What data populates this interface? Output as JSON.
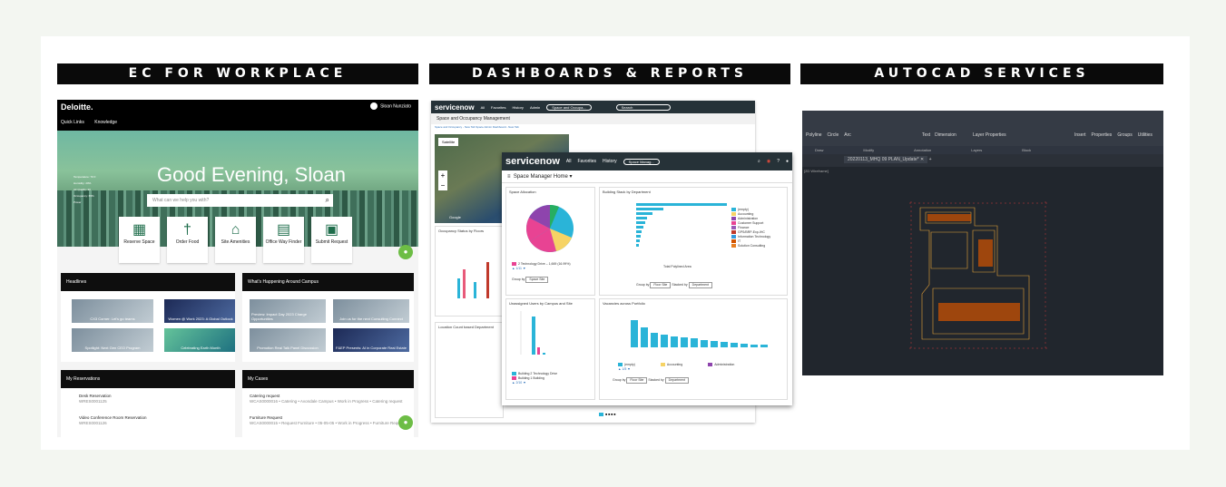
{
  "sections": [
    {
      "title": "EC FOR WORKPLACE"
    },
    {
      "title": "DASHBOARDS & REPORTS"
    },
    {
      "title": "AUTOCAD SERVICES"
    }
  ],
  "workplace": {
    "logo": "Deloitte.",
    "user": "Sloan Nunziato",
    "nav": [
      "Quick Links",
      "Knowledge"
    ],
    "greeting": "Good Evening, Sloan",
    "search_placeholder": "What can we help you with?",
    "weather": [
      "Temperature: 70 F",
      "Humidity: 20%",
      "Air Quality: 30",
      "Occupancy: 65%",
      "Power"
    ],
    "tiles": [
      {
        "icon": "calendar-icon",
        "label": "Reserve Space"
      },
      {
        "icon": "fork-knife-icon",
        "label": "Order Food"
      },
      {
        "icon": "building-icon",
        "label": "Site Amenities"
      },
      {
        "icon": "map-icon",
        "label": "Office Way Finder"
      },
      {
        "icon": "briefcase-icon",
        "label": "Submit Request"
      }
    ],
    "headlines": {
      "title": "Headlines",
      "items": [
        "CX3 Corner: Let's go teams",
        "Women @ Work 2023: A Global Outlook",
        "Spotlight: Next Gen CEO Program",
        "Celebrating Earth Month"
      ]
    },
    "campus": {
      "title": "What's Happening Around Campus",
      "items": [
        "Preview: Impact Day 2023 Charge Opportunities",
        "Join us for the next Consulting Connect",
        "Promotion Real Talk Panel Discussion",
        "F&EP Presents: AI in Corporate Real Estate"
      ]
    },
    "reservations": {
      "title": "My Reservations",
      "items": [
        {
          "name": "Desk Reservation",
          "id": "WRES0001125"
        },
        {
          "name": "Video Conference Room Reservation",
          "id": "WRES0001126"
        }
      ]
    },
    "cases": {
      "title": "My Cases",
      "items": [
        {
          "name": "Catering request",
          "detail": "WCAS0000016 • Catering • Avondale Campus • Work in Progress • Catering request"
        },
        {
          "name": "Furniture Request",
          "detail": "WCAS0000015 • Request Furniture • 05-05-05 • Work in Progress • Furniture Request"
        }
      ]
    }
  },
  "dashboard_back": {
    "logo": "servicenow",
    "menu": [
      "All",
      "Favorites",
      "History",
      "Admin"
    ],
    "pill": "Space and Occupa...",
    "search": "Search",
    "subtitle": "Space and Occupancy Management",
    "tabs": "Space and Occupancy - New Tab  Space Admin Dashboard - New Tab",
    "map_mode": "Satellite",
    "map_credit": "Google",
    "occ_title": "Occupancy Status by Floors",
    "loc_title": "Location Count based Department"
  },
  "dashboard_front": {
    "logo": "servicenow",
    "menu": [
      "All",
      "Favorites",
      "History"
    ],
    "pill": "Space Manag...",
    "title": "Space Manager Home",
    "space_alloc": {
      "title": "Space Allocation",
      "legend": "2 Technology Drive – 1,669 (16.99%)",
      "pager": "1/11",
      "group_label": "Group by",
      "group_value": "Space Site"
    },
    "building_stack": {
      "title": "Building Stack by Department",
      "legend": [
        "(empty)",
        "Accounting",
        "Administration",
        "Customer Support",
        "Finance",
        "GPS/BRP-Exp-IHC",
        "Information Technology",
        "IT",
        "Solution Consulting"
      ],
      "x_label": "Total Polylined Area",
      "group_label": "Group by",
      "group_value": "Floor Site",
      "stack_label": "Stacked by",
      "stack_value": "Department"
    },
    "unassigned": {
      "title": "Unassigned Users by Campus and Site",
      "legend": [
        "Building 2 Technology Drive",
        "Building 1 Building"
      ],
      "pager": "2/10",
      "group_label": "Group by",
      "group_value": "Space Site"
    },
    "vacancies": {
      "title": "Vacancies across Portfolio",
      "legend": [
        "(empty)",
        "Accounting",
        "Administration"
      ],
      "pager": "1/5",
      "group_label": "Group by",
      "group_value": "Floor Site",
      "stack_label": "Stacked by",
      "stack_value": "Department"
    }
  },
  "autocad": {
    "ribbon": [
      "Polyline",
      "Circle",
      "Arc",
      "Text",
      "Dimension",
      "Layer Properties",
      "Insert",
      "Properties",
      "Groups",
      "Utilities"
    ],
    "panels": [
      "Draw",
      "Modify",
      "Annotation",
      "Layers",
      "Block"
    ],
    "tab": "20220113_MHQ 09 PLAN_Update*",
    "viewport": "[2D Wireframe]"
  },
  "colors": {
    "background": "#f3f6f1",
    "band": "#0a0a0a",
    "servicenow_bar": "#263238",
    "chart_cyan": "#2ab4d8",
    "green_accent": "#6dbd45"
  }
}
